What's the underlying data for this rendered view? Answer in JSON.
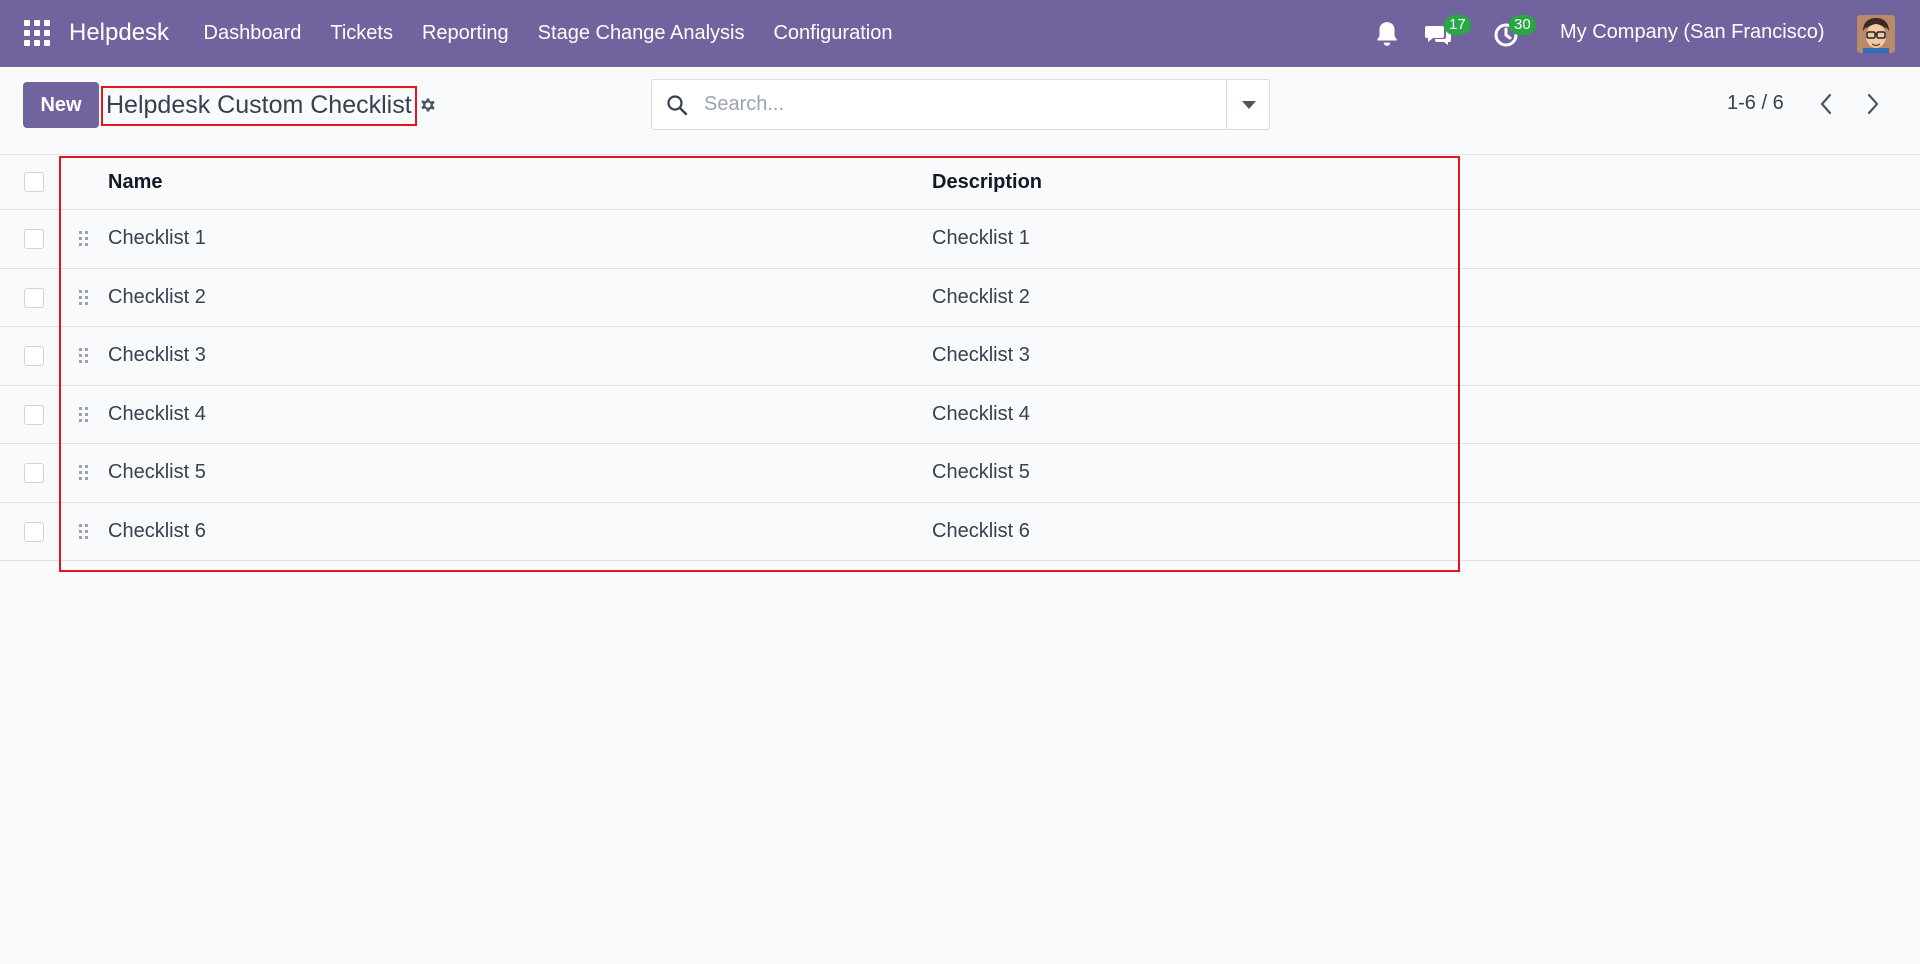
{
  "navbar": {
    "brand": "Helpdesk",
    "menu": [
      {
        "label": "Dashboard"
      },
      {
        "label": "Tickets"
      },
      {
        "label": "Reporting"
      },
      {
        "label": "Stage Change Analysis"
      },
      {
        "label": "Configuration"
      }
    ],
    "messages_badge": "17",
    "activities_badge": "30",
    "company": "My Company (San Francisco)"
  },
  "control_panel": {
    "new_label": "New",
    "title": "Helpdesk Custom Checklist",
    "search_placeholder": "Search...",
    "pager_value": "1-6 / 6"
  },
  "table": {
    "columns": {
      "name": "Name",
      "description": "Description"
    },
    "rows": [
      {
        "name": "Checklist 1",
        "description": "Checklist 1"
      },
      {
        "name": "Checklist 2",
        "description": "Checklist 2"
      },
      {
        "name": "Checklist 3",
        "description": "Checklist 3"
      },
      {
        "name": "Checklist 4",
        "description": "Checklist 4"
      },
      {
        "name": "Checklist 5",
        "description": "Checklist 5"
      },
      {
        "name": "Checklist 6",
        "description": "Checklist 6"
      }
    ]
  },
  "icons": {
    "apps": "apps-grid-icon",
    "bell": "bell-icon",
    "chat": "chat-icon",
    "activity": "clock-icon",
    "gear": "gear-icon",
    "search": "search-icon",
    "dropdown": "caret-down-icon",
    "prev": "chevron-left-icon",
    "next": "chevron-right-icon",
    "drag": "drag-handle-icon"
  },
  "colors": {
    "brand": "#71639e",
    "badge": "#28a745",
    "highlight": "#e3161c",
    "background": "#f9fafb"
  }
}
